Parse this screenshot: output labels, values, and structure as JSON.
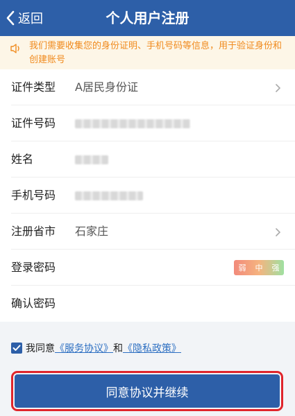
{
  "header": {
    "back_label": "返回",
    "title": "个人用户注册"
  },
  "notice": {
    "icon": "speaker-icon",
    "text": "我们需要收集您的身份证明、手机号码等信息，用于验证身份和创建账号"
  },
  "form": {
    "id_type": {
      "label": "证件类型",
      "value": "A居民身份证"
    },
    "id_number": {
      "label": "证件号码"
    },
    "name": {
      "label": "姓名"
    },
    "phone": {
      "label": "手机号码"
    },
    "province": {
      "label": "注册省市",
      "value": "石家庄"
    },
    "password": {
      "label": "登录密码",
      "strength": [
        "弱",
        "中",
        "强"
      ]
    },
    "confirm_password": {
      "label": "确认密码"
    }
  },
  "agreement": {
    "checked": true,
    "prefix": "我同意",
    "service_link": "《服务协议》",
    "conjunction": "和",
    "privacy_link": "《隐私政策》"
  },
  "submit_label": "同意协议并继续",
  "colors": {
    "primary": "#2d5fa8",
    "notice": "#f08a1d",
    "highlight": "#e0252b"
  }
}
